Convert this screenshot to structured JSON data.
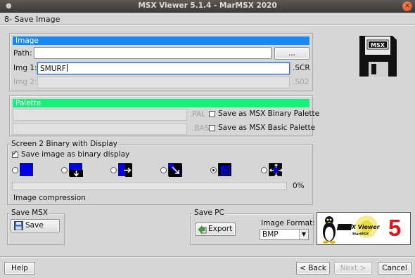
{
  "window": {
    "title": "MSX Viewer 5.1.4 - MarMSX 2020",
    "menu_glyph": "●",
    "close_glyph": "✕"
  },
  "heading": "8- Save Image",
  "image_panel": {
    "title": "Image",
    "path_label": "Path:",
    "path_value": "",
    "browse_label": "...",
    "img1_label": "Img 1:",
    "img1_value": "SMURF",
    "img1_ext": ".SCR",
    "img2_label": "Img 2:",
    "img2_value": "",
    "img2_ext": ".S02"
  },
  "palette_panel": {
    "title": "Palette",
    "pal_ext": ".PAL",
    "bas_ext": ".BAS",
    "binary_palette_label": "Save as MSX Binary Palette",
    "basic_palette_label": "Save as MSX Basic Palette",
    "binary_palette_checked": false,
    "basic_palette_checked": false
  },
  "screen2_panel": {
    "title": "Screen 2 Binary with Display",
    "save_binary_label": "Save image as binary display",
    "save_binary_checked": true,
    "display_modes": [
      "plain",
      "down",
      "right",
      "diagonal",
      "rotate",
      "expand"
    ],
    "selected_mode": 4,
    "progress_percent": 0,
    "progress_text": "0%",
    "compression_label": "Image compression"
  },
  "save_msx": {
    "title": "Save MSX",
    "button_label": "Save"
  },
  "save_pc": {
    "title": "Save PC",
    "button_label": "Export",
    "format_label": "Image Format:",
    "format_value": "BMP"
  },
  "logo": {
    "text": "MSX Viewer",
    "author": "MarMSX",
    "version": "5"
  },
  "footer": {
    "help": "Help",
    "back": "< Back",
    "next": "Next >",
    "cancel": "Cancel"
  },
  "colors": {
    "image_bar": "#1a86f0",
    "palette_bar": "#14f07a",
    "display_blue": "#0000e8",
    "logo_red": "#e01515"
  }
}
